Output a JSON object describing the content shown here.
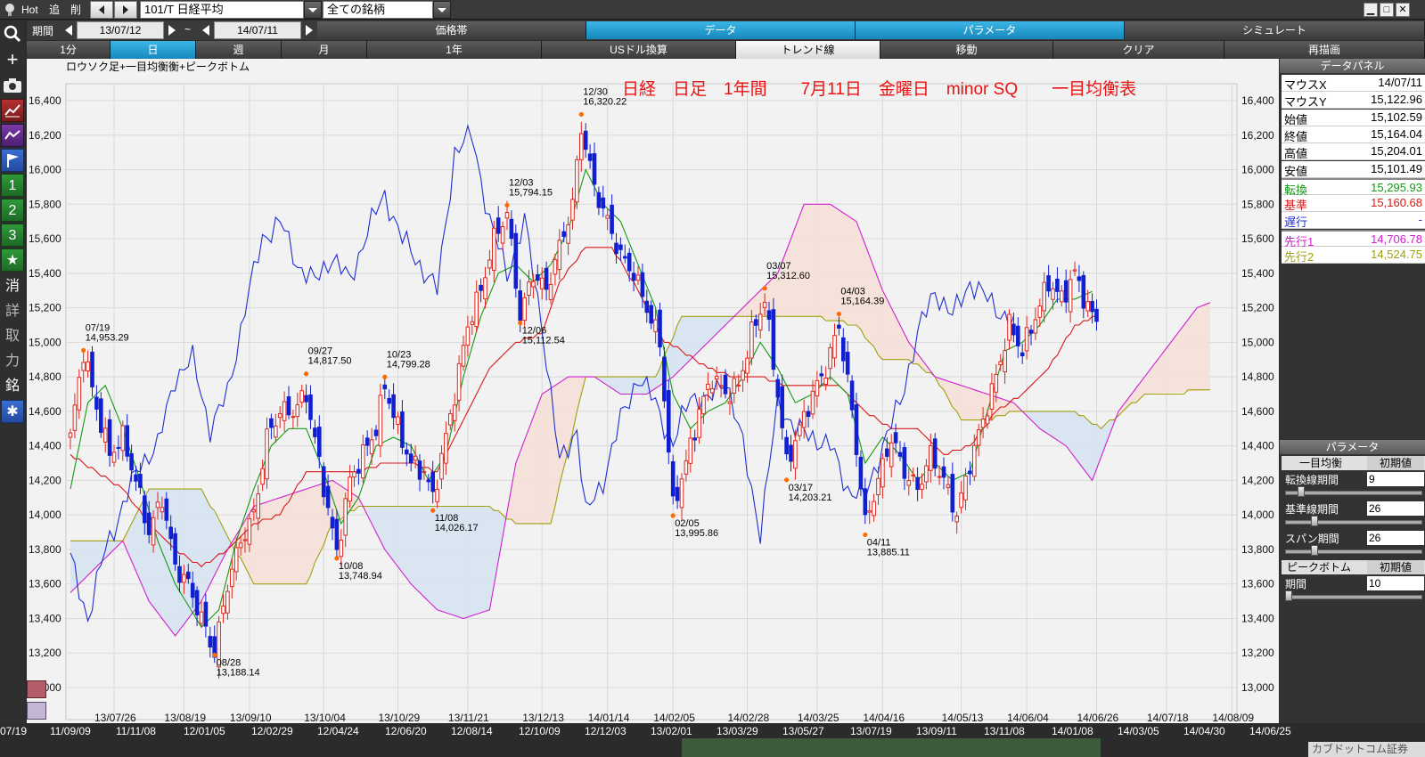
{
  "topbar": {
    "hot": "Hot",
    "add": "追",
    "del": "削",
    "symbol": "101/T 日経平均",
    "group": "全ての銘柄"
  },
  "toolbar": {
    "period_label": "期間",
    "date_from": "13/07/12",
    "tilde": "~",
    "date_to": "14/07/11",
    "tabs": [
      "価格帯",
      "データ",
      "パラメータ",
      "シミュレート"
    ]
  },
  "timeframes": [
    "1分",
    "日",
    "週",
    "月",
    "1年",
    "USドル換算",
    "トレンド線",
    "移動",
    "クリア",
    "再描画"
  ],
  "left_tools": [
    "+",
    "消",
    "詳",
    "取",
    "力",
    "銘"
  ],
  "left_numbers": [
    "1",
    "2",
    "3"
  ],
  "chart_label": "ロウソク足+一目均衡衡+ピークボトム",
  "chart_title": "日経　日足　1年間　　7月11日　金曜日　minor SQ　　一目均衡表",
  "colors": {
    "up": "#e0261d",
    "down": "#1020d0",
    "conversion": "#139a13",
    "base": "#d81818",
    "lagging": "#1f2fd0",
    "span1": "#d020d0",
    "span2": "#a0a010",
    "cloud_warm": "#f6dfd6",
    "cloud_cool": "#d6e3f2",
    "chart_bg": "#f2f2f2"
  },
  "data_panel": {
    "header": "データパネル",
    "rows": [
      {
        "k": "マウスX",
        "v": "14/07/11"
      },
      {
        "k": "マウスY",
        "v": "15,122.96"
      },
      {
        "k": "始値",
        "v": "15,102.59"
      },
      {
        "k": "終値",
        "v": "15,164.04"
      },
      {
        "k": "高値",
        "v": "15,204.01"
      },
      {
        "k": "安値",
        "v": "15,101.49"
      },
      {
        "k": "転換",
        "v": "15,295.93",
        "color": "#139a13"
      },
      {
        "k": "基準",
        "v": "15,160.68",
        "color": "#d81818"
      },
      {
        "k": "遅行",
        "v": "-",
        "color": "#1f2fd0"
      },
      {
        "k": "先行1",
        "v": "14,706.78",
        "color": "#d020d0"
      },
      {
        "k": "先行2",
        "v": "14,524.75",
        "color": "#a0a010"
      }
    ]
  },
  "param_panel": {
    "header": "パラメータ",
    "ichimoku": "一目均衡",
    "reset": "初期値",
    "conv_label": "転換線期間",
    "conv_val": "9",
    "conv_level": 0.1,
    "base_label": "基準線期間",
    "base_val": "26",
    "base_level": 0.2,
    "span_label": "スパン期間",
    "span_val": "26",
    "span_level": 0.2,
    "pb_title": "ピークボトム",
    "pb_reset": "初期値",
    "pb_label": "期間",
    "pb_val": "10",
    "pb_level": 0.0
  },
  "bottom_dates": [
    "07/19",
    "11/09/09",
    "11/11/08",
    "12/01/05",
    "12/02/29",
    "12/04/24",
    "12/06/20",
    "12/08/14",
    "12/10/09",
    "12/12/03",
    "13/02/01",
    "13/03/29",
    "13/05/27",
    "13/07/19",
    "13/09/11",
    "13/11/08",
    "14/01/08",
    "14/03/05",
    "14/04/30",
    "14/06/25"
  ],
  "bottom_brand": "カブドットコム証券",
  "chart_data": {
    "type": "candlestick",
    "y_ticks": [
      "16,400",
      "16,200",
      "16,000",
      "15,800",
      "15,600",
      "15,400",
      "15,200",
      "15,000",
      "14,800",
      "14,600",
      "14,400",
      "14,200",
      "14,000",
      "13,800",
      "13,600",
      "13,400",
      "13,200",
      "13,000"
    ],
    "ylim": [
      13000,
      16400
    ],
    "x_ticks": [
      "13/07/26",
      "13/08/19",
      "13/09/10",
      "13/10/04",
      "13/10/29",
      "13/11/21",
      "13/12/13",
      "14/01/14",
      "14/02/05",
      "14/02/28",
      "14/03/25",
      "14/04/16",
      "14/05/13",
      "14/06/04",
      "14/06/26",
      "14/07/18",
      "14/08/09"
    ],
    "x_tick_index": [
      10,
      26,
      41,
      58,
      75,
      91,
      108,
      123,
      138,
      155,
      171,
      186,
      204,
      219,
      235,
      251,
      266
    ],
    "annotations": [
      {
        "date": "07/19",
        "value": "14,953.29",
        "i": 3,
        "y": 14953.29,
        "peak": true
      },
      {
        "date": "08/28",
        "value": "13,188.14",
        "i": 33,
        "y": 13188.14,
        "peak": false
      },
      {
        "date": "09/27",
        "value": "14,817.50",
        "i": 54,
        "y": 14817.5,
        "peak": true
      },
      {
        "date": "10/08",
        "value": "13,748.94",
        "i": 61,
        "y": 13748.94,
        "peak": false
      },
      {
        "date": "10/23",
        "value": "14,799.28",
        "i": 72,
        "y": 14799.28,
        "peak": true
      },
      {
        "date": "11/08",
        "value": "14,026.17",
        "i": 83,
        "y": 14026.17,
        "peak": false
      },
      {
        "date": "12/03",
        "value": "15,794.15",
        "i": 100,
        "y": 15794.15,
        "peak": true
      },
      {
        "date": "12/06",
        "value": "15,112.54",
        "i": 103,
        "y": 15112.54,
        "peak": false
      },
      {
        "date": "12/30",
        "value": "16,320.22",
        "i": 117,
        "y": 16320.22,
        "peak": true
      },
      {
        "date": "02/05",
        "value": "13,995.86",
        "i": 138,
        "y": 13995.86,
        "peak": false
      },
      {
        "date": "03/07",
        "value": "15,312.60",
        "i": 159,
        "y": 15312.6,
        "peak": true
      },
      {
        "date": "03/17",
        "value": "14,203.21",
        "i": 164,
        "y": 14203.21,
        "peak": false
      },
      {
        "date": "04/03",
        "value": "15,164.39",
        "i": 176,
        "y": 15164.39,
        "peak": true
      },
      {
        "date": "04/11",
        "value": "13,885.11",
        "i": 182,
        "y": 13885.11,
        "peak": false
      }
    ],
    "close_anchors": [
      [
        0,
        14450
      ],
      [
        3,
        14950
      ],
      [
        6,
        14620
      ],
      [
        9,
        14350
      ],
      [
        12,
        14450
      ],
      [
        15,
        14200
      ],
      [
        18,
        13900
      ],
      [
        21,
        14100
      ],
      [
        24,
        13700
      ],
      [
        27,
        13600
      ],
      [
        30,
        13400
      ],
      [
        33,
        13200
      ],
      [
        36,
        13600
      ],
      [
        39,
        13850
      ],
      [
        42,
        14000
      ],
      [
        45,
        14450
      ],
      [
        48,
        14600
      ],
      [
        51,
        14600
      ],
      [
        54,
        14700
      ],
      [
        57,
        14300
      ],
      [
        60,
        13900
      ],
      [
        61,
        13780
      ],
      [
        64,
        14200
      ],
      [
        67,
        14350
      ],
      [
        70,
        14500
      ],
      [
        72,
        14750
      ],
      [
        75,
        14500
      ],
      [
        78,
        14300
      ],
      [
        81,
        14250
      ],
      [
        83,
        14100
      ],
      [
        86,
        14450
      ],
      [
        88,
        14700
      ],
      [
        91,
        15100
      ],
      [
        94,
        15300
      ],
      [
        97,
        15600
      ],
      [
        100,
        15750
      ],
      [
        103,
        15150
      ],
      [
        106,
        15400
      ],
      [
        109,
        15300
      ],
      [
        112,
        15550
      ],
      [
        115,
        15800
      ],
      [
        117,
        16250
      ],
      [
        120,
        15900
      ],
      [
        123,
        15700
      ],
      [
        126,
        15500
      ],
      [
        129,
        15400
      ],
      [
        132,
        15200
      ],
      [
        135,
        15000
      ],
      [
        138,
        14050
      ],
      [
        141,
        14300
      ],
      [
        144,
        14600
      ],
      [
        147,
        14800
      ],
      [
        150,
        14700
      ],
      [
        153,
        14750
      ],
      [
        156,
        15050
      ],
      [
        159,
        15250
      ],
      [
        162,
        14700
      ],
      [
        164,
        14300
      ],
      [
        167,
        14500
      ],
      [
        170,
        14700
      ],
      [
        173,
        14850
      ],
      [
        176,
        15100
      ],
      [
        179,
        14600
      ],
      [
        182,
        13950
      ],
      [
        185,
        14200
      ],
      [
        188,
        14450
      ],
      [
        191,
        14250
      ],
      [
        194,
        14150
      ],
      [
        197,
        14350
      ],
      [
        200,
        14200
      ],
      [
        203,
        14000
      ],
      [
        206,
        14300
      ],
      [
        209,
        14550
      ],
      [
        212,
        14800
      ],
      [
        215,
        15100
      ],
      [
        218,
        14950
      ],
      [
        221,
        15150
      ],
      [
        224,
        15350
      ],
      [
        227,
        15250
      ],
      [
        230,
        15400
      ],
      [
        233,
        15200
      ],
      [
        235,
        15120
      ]
    ],
    "conversion": [
      [
        0,
        14150
      ],
      [
        4,
        14650
      ],
      [
        8,
        14750
      ],
      [
        12,
        14500
      ],
      [
        16,
        14200
      ],
      [
        20,
        13850
      ],
      [
        24,
        13600
      ],
      [
        30,
        13350
      ],
      [
        34,
        13450
      ],
      [
        38,
        13850
      ],
      [
        42,
        14150
      ],
      [
        46,
        14400
      ],
      [
        50,
        14500
      ],
      [
        54,
        14500
      ],
      [
        58,
        14250
      ],
      [
        62,
        13950
      ],
      [
        66,
        14100
      ],
      [
        70,
        14400
      ],
      [
        74,
        14450
      ],
      [
        78,
        14400
      ],
      [
        82,
        14200
      ],
      [
        86,
        14350
      ],
      [
        90,
        14800
      ],
      [
        94,
        15150
      ],
      [
        98,
        15400
      ],
      [
        102,
        15450
      ],
      [
        106,
        15350
      ],
      [
        110,
        15450
      ],
      [
        114,
        15650
      ],
      [
        118,
        16000
      ],
      [
        122,
        15800
      ],
      [
        126,
        15700
      ],
      [
        130,
        15450
      ],
      [
        134,
        15200
      ],
      [
        138,
        14700
      ],
      [
        142,
        14500
      ],
      [
        146,
        14600
      ],
      [
        150,
        14650
      ],
      [
        154,
        14800
      ],
      [
        158,
        15000
      ],
      [
        162,
        14850
      ],
      [
        166,
        14650
      ],
      [
        170,
        14700
      ],
      [
        174,
        14800
      ],
      [
        178,
        14700
      ],
      [
        182,
        14300
      ],
      [
        186,
        14450
      ],
      [
        190,
        14350
      ],
      [
        194,
        14200
      ],
      [
        198,
        14300
      ],
      [
        202,
        14200
      ],
      [
        206,
        14250
      ],
      [
        210,
        14600
      ],
      [
        214,
        14950
      ],
      [
        218,
        15000
      ],
      [
        222,
        15100
      ],
      [
        226,
        15250
      ],
      [
        230,
        15250
      ],
      [
        234,
        15295
      ]
    ],
    "base": [
      [
        0,
        14350
      ],
      [
        6,
        14250
      ],
      [
        12,
        14150
      ],
      [
        18,
        13950
      ],
      [
        24,
        13800
      ],
      [
        30,
        13700
      ],
      [
        36,
        13800
      ],
      [
        42,
        13950
      ],
      [
        48,
        14000
      ],
      [
        54,
        14250
      ],
      [
        60,
        14250
      ],
      [
        66,
        14250
      ],
      [
        72,
        14300
      ],
      [
        78,
        14300
      ],
      [
        84,
        14250
      ],
      [
        90,
        14550
      ],
      [
        96,
        14850
      ],
      [
        102,
        15000
      ],
      [
        108,
        15050
      ],
      [
        112,
        15350
      ],
      [
        118,
        15550
      ],
      [
        124,
        15550
      ],
      [
        130,
        15300
      ],
      [
        136,
        15000
      ],
      [
        140,
        14950
      ],
      [
        146,
        14850
      ],
      [
        152,
        14800
      ],
      [
        158,
        14800
      ],
      [
        164,
        14750
      ],
      [
        170,
        14750
      ],
      [
        176,
        14750
      ],
      [
        182,
        14600
      ],
      [
        188,
        14500
      ],
      [
        194,
        14500
      ],
      [
        200,
        14350
      ],
      [
        206,
        14400
      ],
      [
        212,
        14600
      ],
      [
        218,
        14700
      ],
      [
        224,
        14850
      ],
      [
        230,
        15100
      ],
      [
        235,
        15160
      ]
    ],
    "lagging": [
      [
        0,
        13750
      ],
      [
        4,
        13400
      ],
      [
        8,
        13800
      ],
      [
        12,
        14050
      ],
      [
        16,
        14300
      ],
      [
        20,
        14400
      ],
      [
        24,
        14800
      ],
      [
        28,
        14900
      ],
      [
        32,
        14500
      ],
      [
        36,
        14700
      ],
      [
        40,
        15200
      ],
      [
        44,
        15600
      ],
      [
        48,
        15700
      ],
      [
        52,
        15450
      ],
      [
        56,
        15350
      ],
      [
        60,
        15500
      ],
      [
        64,
        15350
      ],
      [
        68,
        15650
      ],
      [
        72,
        15850
      ],
      [
        76,
        15600
      ],
      [
        80,
        15450
      ],
      [
        84,
        15300
      ],
      [
        88,
        16100
      ],
      [
        92,
        16200
      ],
      [
        96,
        15700
      ],
      [
        100,
        15400
      ],
      [
        104,
        15700
      ],
      [
        108,
        15100
      ],
      [
        112,
        14300
      ],
      [
        116,
        14500
      ],
      [
        118,
        14000
      ],
      [
        122,
        14200
      ],
      [
        126,
        14550
      ],
      [
        130,
        14800
      ],
      [
        134,
        14650
      ],
      [
        138,
        14400
      ],
      [
        142,
        14700
      ],
      [
        146,
        14650
      ],
      [
        150,
        14800
      ],
      [
        154,
        14400
      ],
      [
        158,
        13900
      ],
      [
        162,
        14650
      ],
      [
        166,
        14500
      ],
      [
        170,
        14450
      ],
      [
        174,
        14400
      ],
      [
        178,
        14150
      ],
      [
        182,
        14100
      ],
      [
        186,
        14400
      ],
      [
        190,
        14650
      ],
      [
        194,
        15050
      ],
      [
        198,
        15300
      ],
      [
        202,
        15150
      ],
      [
        206,
        15350
      ],
      [
        210,
        15250
      ],
      [
        214,
        15150
      ],
      [
        216,
        15100
      ]
    ],
    "span1": [
      [
        0,
        13550
      ],
      [
        6,
        13700
      ],
      [
        12,
        13850
      ],
      [
        18,
        13500
      ],
      [
        24,
        13300
      ],
      [
        30,
        13500
      ],
      [
        36,
        13800
      ],
      [
        42,
        14050
      ],
      [
        48,
        14100
      ],
      [
        54,
        14150
      ],
      [
        60,
        14200
      ],
      [
        66,
        14100
      ],
      [
        72,
        13800
      ],
      [
        78,
        13600
      ],
      [
        84,
        13450
      ],
      [
        90,
        13400
      ],
      [
        96,
        13450
      ],
      [
        102,
        14300
      ],
      [
        108,
        14700
      ],
      [
        114,
        14800
      ],
      [
        120,
        14800
      ],
      [
        126,
        14700
      ],
      [
        132,
        14700
      ],
      [
        138,
        14800
      ],
      [
        144,
        14950
      ],
      [
        150,
        15100
      ],
      [
        156,
        15250
      ],
      [
        162,
        15400
      ],
      [
        168,
        15800
      ],
      [
        174,
        15800
      ],
      [
        180,
        15700
      ],
      [
        186,
        15300
      ],
      [
        192,
        15000
      ],
      [
        198,
        14800
      ],
      [
        204,
        14750
      ],
      [
        210,
        14700
      ],
      [
        216,
        14650
      ],
      [
        222,
        14500
      ],
      [
        228,
        14400
      ],
      [
        234,
        14200
      ],
      [
        240,
        14600
      ],
      [
        246,
        14800
      ],
      [
        252,
        15000
      ],
      [
        258,
        15200
      ],
      [
        261,
        15230
      ]
    ],
    "span2": [
      [
        0,
        13850
      ],
      [
        12,
        13850
      ],
      [
        18,
        14150
      ],
      [
        30,
        14150
      ],
      [
        42,
        13600
      ],
      [
        54,
        13600
      ],
      [
        60,
        13950
      ],
      [
        66,
        14050
      ],
      [
        78,
        14050
      ],
      [
        84,
        14050
      ],
      [
        96,
        14050
      ],
      [
        102,
        13950
      ],
      [
        110,
        13950
      ],
      [
        118,
        14800
      ],
      [
        124,
        14800
      ],
      [
        134,
        14800
      ],
      [
        140,
        15150
      ],
      [
        150,
        15150
      ],
      [
        162,
        15150
      ],
      [
        170,
        15150
      ],
      [
        180,
        15100
      ],
      [
        186,
        14900
      ],
      [
        192,
        14900
      ],
      [
        198,
        14800
      ],
      [
        204,
        14550
      ],
      [
        210,
        14550
      ],
      [
        216,
        14600
      ],
      [
        222,
        14600
      ],
      [
        230,
        14600
      ],
      [
        236,
        14500
      ],
      [
        246,
        14700
      ],
      [
        261,
        14720
      ]
    ]
  }
}
